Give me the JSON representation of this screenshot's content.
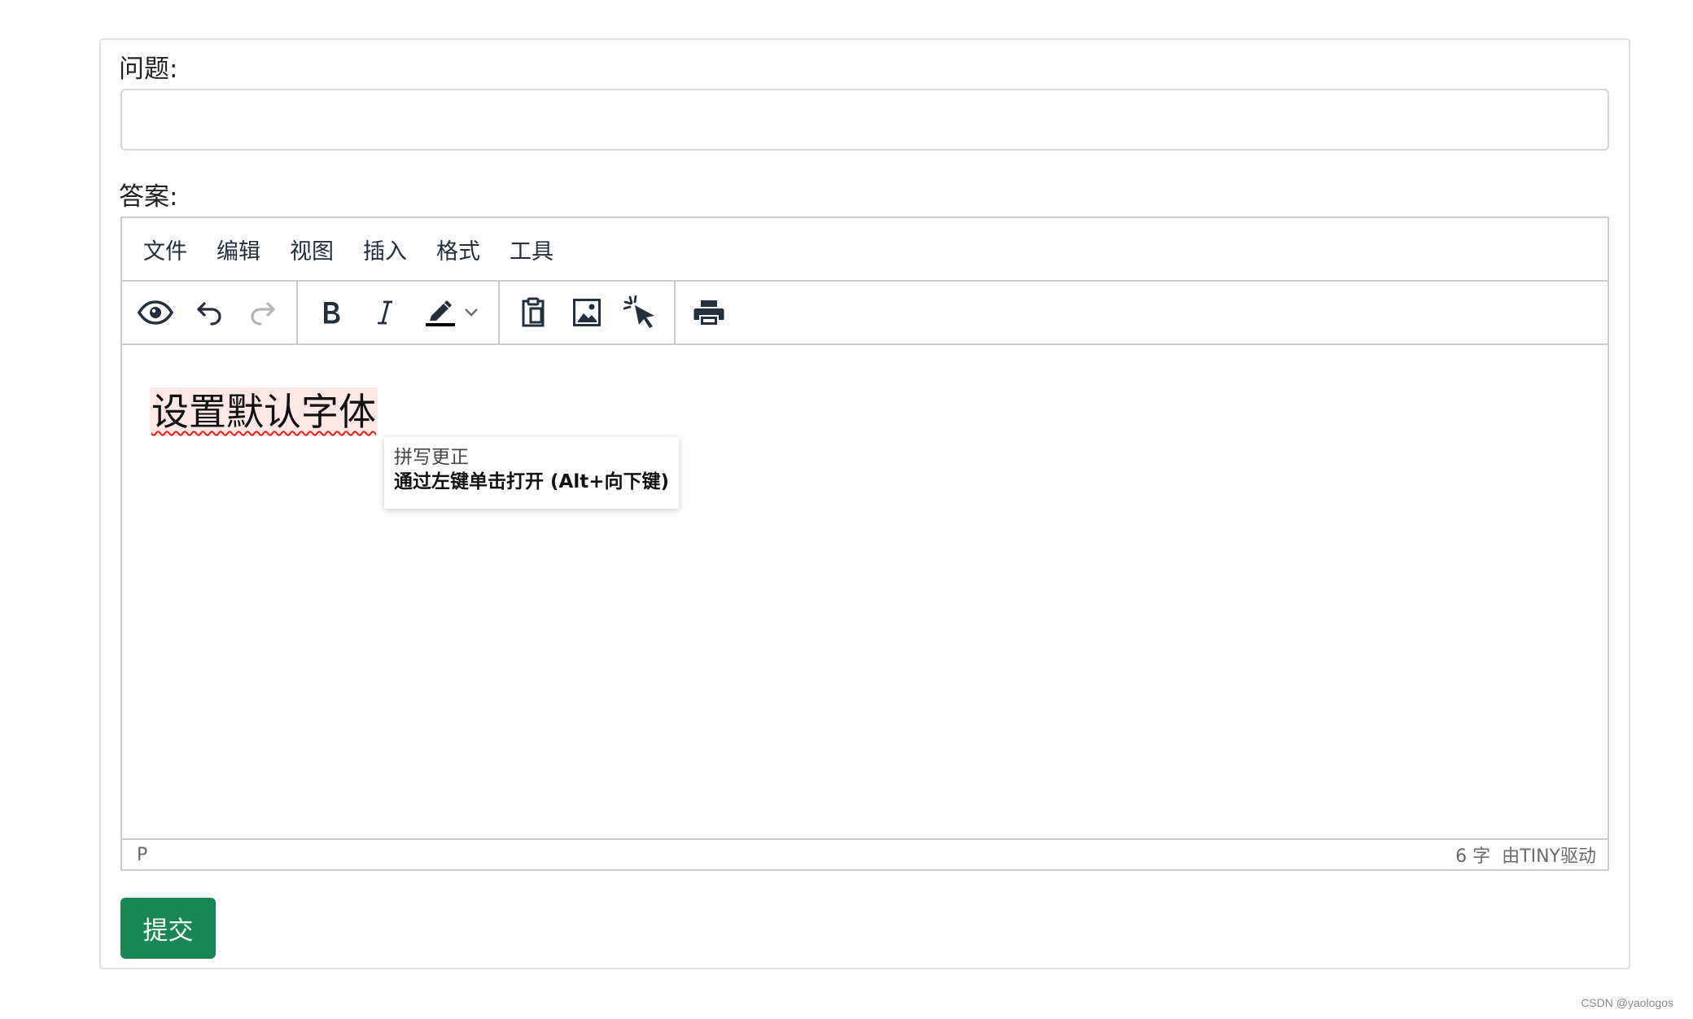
{
  "form": {
    "question_label": "问题:",
    "question_value": "",
    "answer_label": "答案:",
    "submit_label": "提交",
    "submit_color": "#198754"
  },
  "editor": {
    "menubar": [
      "文件",
      "编辑",
      "视图",
      "插入",
      "格式",
      "工具"
    ],
    "toolbar_groups": [
      [
        "preview-icon",
        "undo-icon",
        "redo-icon"
      ],
      [
        "bold-icon",
        "italic-icon",
        "highlight-color-icon"
      ],
      [
        "paste-icon",
        "image-icon",
        "spellcheck-icon"
      ],
      [
        "print-icon"
      ]
    ],
    "content_text": "设置默认字体",
    "tooltip": {
      "title": "拼写更正",
      "hint": "通过左键单击打开 (Alt+向下键)"
    },
    "statusbar": {
      "path": "P",
      "word_count": "6 字",
      "branding": "由TINY驱动"
    }
  },
  "watermark": "CSDN @yaologos"
}
